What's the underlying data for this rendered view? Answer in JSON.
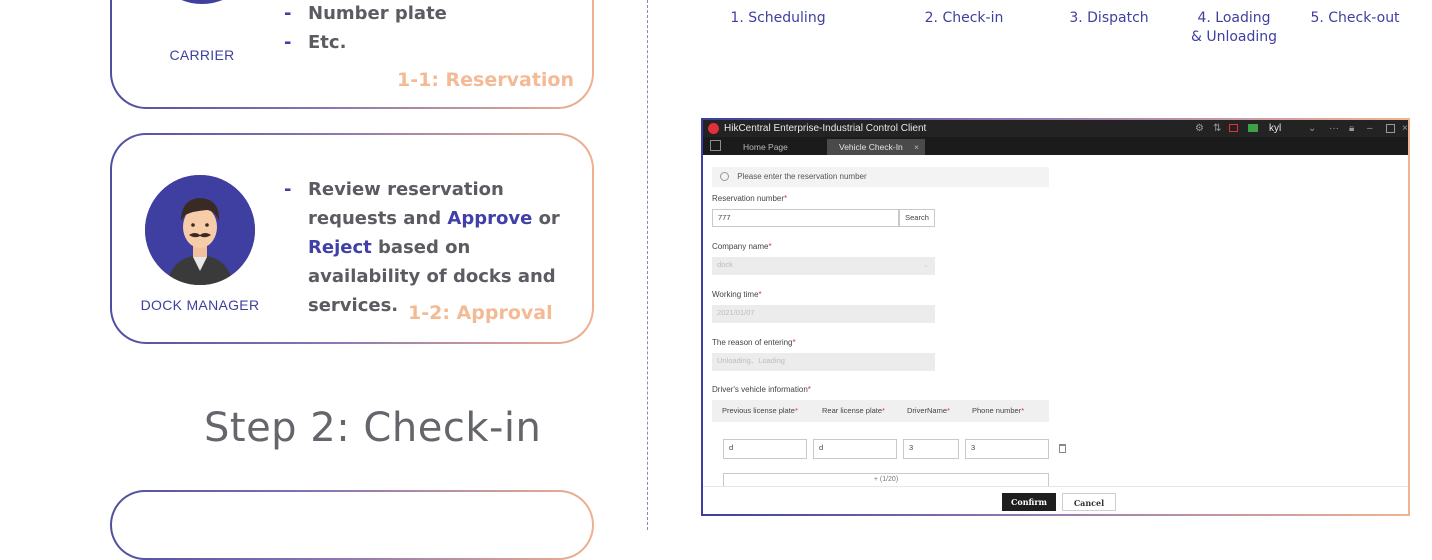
{
  "cards": {
    "carrier": {
      "role": "CARRIER",
      "bullets": [
        "Number plate",
        "Etc."
      ],
      "tag": "1-1: Reservation"
    },
    "dock_manager": {
      "role": "DOCK MANAGER",
      "bullet": {
        "part1": "Review reservation requests and ",
        "approve": "Approve",
        "part2": " or ",
        "reject": "Reject",
        "part3": " based on availability of docks and services."
      },
      "tag": "1-2: Approval"
    }
  },
  "step2_title": "Step 2: Check-in",
  "timeline": {
    "steps": [
      "1. Scheduling",
      "2. Check-in",
      "3. Dispatch",
      "4. Loading",
      "5. Check-out"
    ],
    "step4_line2": "& Unloading"
  },
  "app": {
    "window_title": "HikCentral Enterprise-Industrial Control Client",
    "user": "kyl",
    "tabs": [
      "Home Page",
      "Vehicle Check-In"
    ],
    "hint": "Please enter the reservation number",
    "reservation_label": "Reservation number",
    "reservation_value": "777",
    "search_button": "Search",
    "company_label": "Company name",
    "company_value": "dock",
    "working_time_label": "Working time",
    "working_time_value": "2021/01/07",
    "reason_label": "The reason of entering",
    "reason_value": "Unloading、Loading",
    "vehicle_label": "Driver's vehicle information",
    "columns": [
      "Previous license plate",
      "Rear license plate",
      "DriverName",
      "Phone number"
    ],
    "row": [
      "d",
      "d",
      "3",
      "3"
    ],
    "add_row": "+ (1/20)",
    "confirm": "Confirm",
    "cancel": "Cancel"
  },
  "colors": {
    "brand_blue": "#3f3fa0",
    "accent_peach": "#f4b995",
    "app_dark": "#232323",
    "required": "#e0303c"
  }
}
